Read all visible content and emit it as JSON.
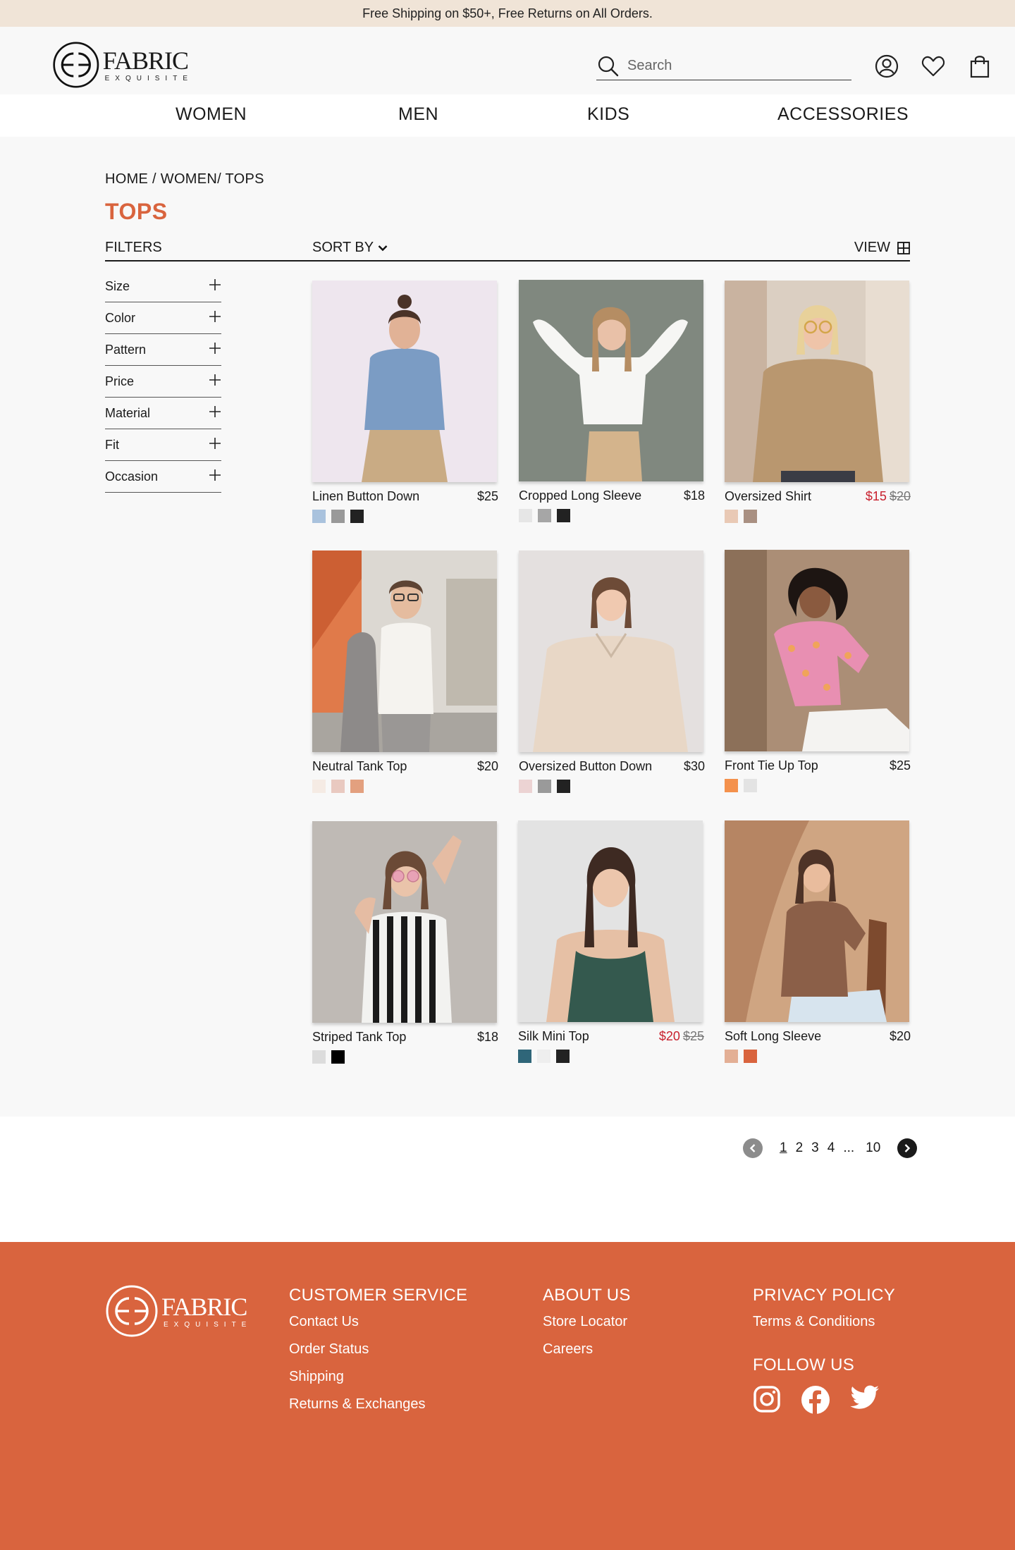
{
  "promo": {
    "text": "Free Shipping on $50+, Free Returns on All Orders."
  },
  "brand": {
    "name": "FABRIC",
    "tagline": "EXQUISITE"
  },
  "search": {
    "placeholder": "Search"
  },
  "header_icons": [
    "account-icon",
    "heart-icon",
    "bag-icon"
  ],
  "nav": [
    {
      "label": "WOMEN"
    },
    {
      "label": "MEN"
    },
    {
      "label": "KIDS"
    },
    {
      "label": "ACCESSORIES"
    }
  ],
  "breadcrumb": "HOME / WOMEN/ TOPS",
  "page_title": "TOPS",
  "toolbar": {
    "filters": "FILTERS",
    "sort_by": "SORT BY",
    "view": "VIEW"
  },
  "filters": [
    {
      "label": "Size"
    },
    {
      "label": "Color"
    },
    {
      "label": "Pattern"
    },
    {
      "label": "Price"
    },
    {
      "label": "Material"
    },
    {
      "label": "Fit"
    },
    {
      "label": "Occasion"
    }
  ],
  "products": [
    {
      "name": "Linen Button Down",
      "price": "$25",
      "old_price": "",
      "swatches": [
        "#a9c2dd",
        "#999999",
        "#222222"
      ]
    },
    {
      "name": "Cropped Long Sleeve",
      "price": "$18",
      "old_price": "",
      "swatches": [
        "#e6e6e6",
        "#a6a6a6",
        "#222222"
      ]
    },
    {
      "name": "Oversized Shirt",
      "price": "$15",
      "old_price": "$20",
      "swatches": [
        "#e9c9b5",
        "#a99082"
      ]
    },
    {
      "name": "Neutral Tank Top",
      "price": "$20",
      "old_price": "",
      "swatches": [
        "#f5ebe4",
        "#e9c9c0",
        "#e3a07f"
      ]
    },
    {
      "name": "Oversized Button Down",
      "price": "$30",
      "old_price": "",
      "swatches": [
        "#ecd3d3",
        "#9a9a9a",
        "#222222"
      ]
    },
    {
      "name": "Front Tie Up Top",
      "price": "$25",
      "old_price": "",
      "swatches": [
        "#f4914c",
        "#e3e3e3"
      ]
    },
    {
      "name": "Striped Tank Top",
      "price": "$18",
      "old_price": "",
      "swatches": [
        "#dcdcdc",
        "#000000"
      ]
    },
    {
      "name": "Silk Mini Top",
      "price": "$20",
      "old_price": "$25",
      "swatches": [
        "#2f6679",
        "#eeeeee",
        "#222222"
      ]
    },
    {
      "name": "Soft Long Sleeve",
      "price": "$20",
      "old_price": "",
      "swatches": [
        "#e3af95",
        "#d9643e"
      ]
    }
  ],
  "pagination": {
    "pages": [
      "1",
      "2",
      "3",
      "4",
      "...",
      "10"
    ],
    "current": "1"
  },
  "footer": {
    "customer_service": {
      "heading": "CUSTOMER SERVICE",
      "links": [
        "Contact Us",
        "Order Status",
        "Shipping",
        "Returns & Exchanges"
      ]
    },
    "about": {
      "heading": "ABOUT US",
      "links": [
        "Store Locator",
        "Careers"
      ]
    },
    "privacy": {
      "heading": "PRIVACY POLICY",
      "links": [
        "Terms & Conditions"
      ]
    },
    "follow": {
      "heading": "FOLLOW US",
      "icons": [
        "instagram-icon",
        "facebook-icon",
        "twitter-icon"
      ]
    }
  },
  "colors": {
    "accent": "#d9643e",
    "promo_bg": "#f0e4d7",
    "sale": "#c8202d"
  }
}
